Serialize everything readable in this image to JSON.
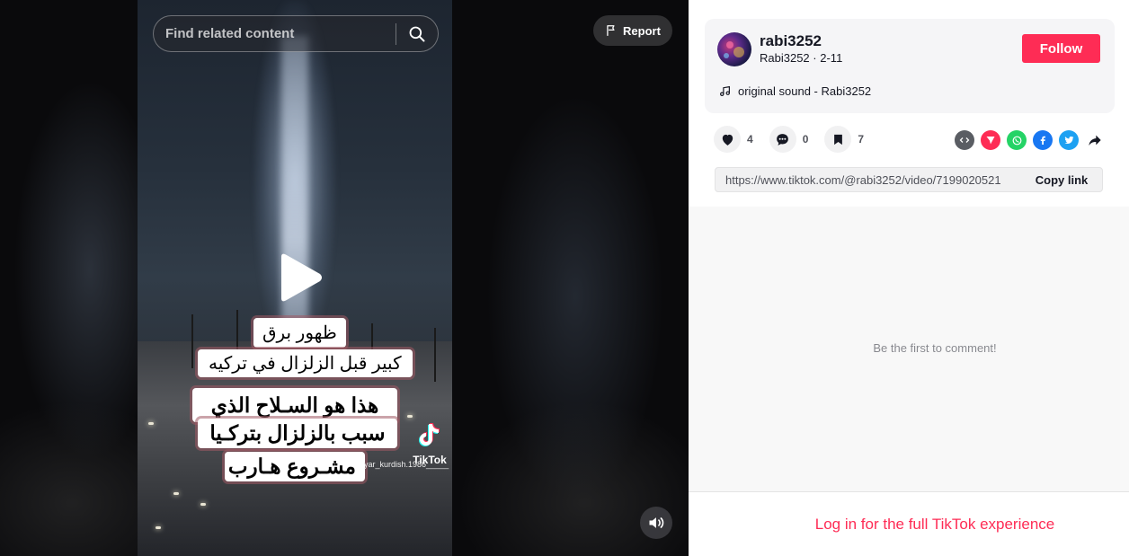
{
  "search": {
    "placeholder": "Find related content"
  },
  "report": {
    "label": "Report"
  },
  "video": {
    "captions": [
      "ظهور برق",
      "كبير قبل الزلزال في تركيه",
      "هذا هو السـلاح الذي",
      "سبب بالزلزال بتركـيا",
      "مشـروع هـارب"
    ],
    "watermark": {
      "brand": "TikTok",
      "username": "yar_kurdish.1986_____"
    }
  },
  "author": {
    "username": "rabi3252",
    "nickname": "Rabi3252",
    "date": "2-11",
    "separator": "·",
    "follow_label": "Follow"
  },
  "music": {
    "title": "original sound - Rabi3252"
  },
  "stats": {
    "likes": "4",
    "comments": "0",
    "saves": "7"
  },
  "share_icons": [
    "embed-icon",
    "send-icon",
    "whatsapp-icon",
    "facebook-icon",
    "twitter-icon",
    "share-arrow-icon"
  ],
  "link": {
    "url": "https://www.tiktok.com/@rabi3252/video/7199020521",
    "copy_label": "Copy link"
  },
  "comments": {
    "empty_text": "Be the first to comment!"
  },
  "login": {
    "label": "Log in for the full TikTok experience"
  },
  "colors": {
    "accent": "#fe2c55",
    "text": "#161823"
  }
}
